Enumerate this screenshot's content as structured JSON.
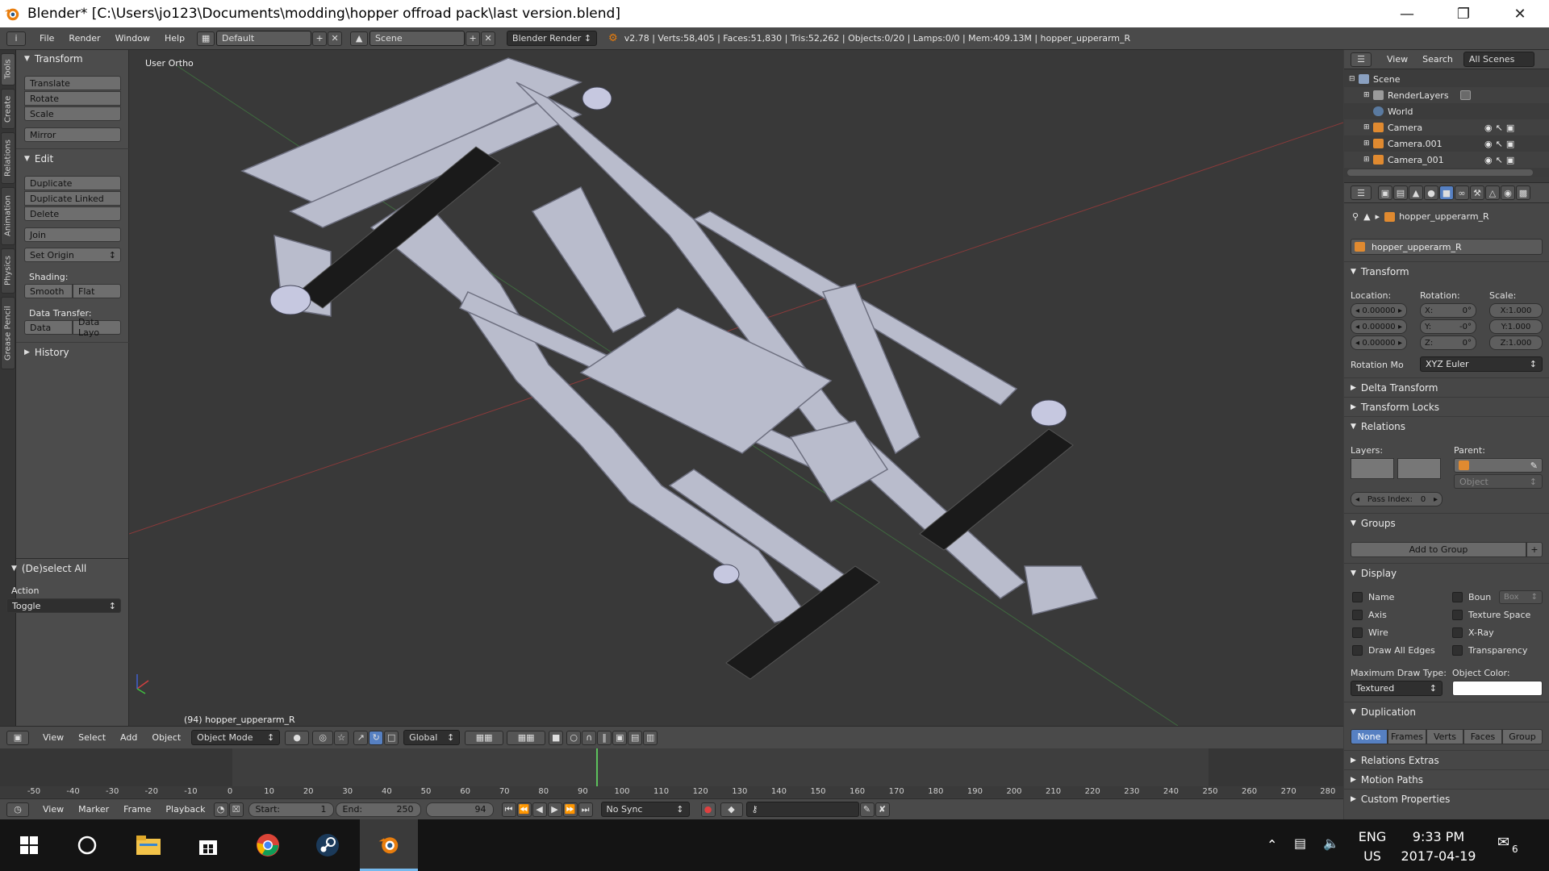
{
  "window": {
    "title": "Blender* [C:\\Users\\jo123\\Documents\\modding\\hopper offroad pack\\last version.blend]"
  },
  "info_header": {
    "menus": [
      "File",
      "Render",
      "Window",
      "Help"
    ],
    "layout": "Default",
    "scene": "Scene",
    "engine": "Blender Render",
    "stats": "v2.78 | Verts:58,405 | Faces:51,830 | Tris:52,262 | Objects:0/20 | Lamps:0/0 | Mem:409.13M | hopper_upperarm_R"
  },
  "tool_tabs": [
    "Tools",
    "Create",
    "Relations",
    "Animation",
    "Physics",
    "Grease Pencil"
  ],
  "tool_shelf": {
    "transform_header": "Transform",
    "translate": "Translate",
    "rotate": "Rotate",
    "scale": "Scale",
    "mirror": "Mirror",
    "edit_header": "Edit",
    "duplicate": "Duplicate",
    "duplicate_linked": "Duplicate Linked",
    "delete": "Delete",
    "join": "Join",
    "set_origin": "Set Origin",
    "shading_label": "Shading:",
    "smooth": "Smooth",
    "flat": "Flat",
    "data_transfer_label": "Data Transfer:",
    "data": "Data",
    "data_layout": "Data Layo",
    "history_header": "History",
    "deselect_header": "(De)select All",
    "action_label": "Action",
    "action_value": "Toggle"
  },
  "viewport": {
    "view_label": "User Ortho",
    "object_label": "(94) hopper_upperarm_R"
  },
  "view3d_header": {
    "menus": [
      "View",
      "Select",
      "Add",
      "Object"
    ],
    "mode": "Object Mode",
    "orientation": "Global"
  },
  "timeline": {
    "ticks": [
      "-50",
      "-40",
      "-30",
      "-20",
      "-10",
      "0",
      "10",
      "20",
      "30",
      "40",
      "50",
      "60",
      "70",
      "80",
      "90",
      "100",
      "110",
      "120",
      "130",
      "140",
      "150",
      "160",
      "170",
      "180",
      "190",
      "200",
      "210",
      "220",
      "230",
      "240",
      "250",
      "260",
      "270",
      "280"
    ],
    "current_frame": 94,
    "menus": [
      "View",
      "Marker",
      "Frame",
      "Playback"
    ],
    "start_label": "Start:",
    "start": "1",
    "end_label": "End:",
    "end": "250",
    "frame": "94",
    "sync": "No Sync"
  },
  "outliner": {
    "menus": [
      "View",
      "Search"
    ],
    "filter": "All Scenes",
    "items": [
      "Scene",
      "RenderLayers",
      "World",
      "Camera",
      "Camera.001",
      "Camera_001"
    ]
  },
  "properties": {
    "breadcrumb": "hopper_upperarm_R",
    "object_name": "hopper_upperarm_R",
    "transform_header": "Transform",
    "location_label": "Location:",
    "rotation_label": "Rotation:",
    "scale_label": "Scale:",
    "location": [
      "0.00000",
      "0.00000",
      "0.00000"
    ],
    "rotation": [
      {
        "axis": "X:",
        "value": "0°"
      },
      {
        "axis": "Y:",
        "value": "-0°"
      },
      {
        "axis": "Z:",
        "value": "0°"
      }
    ],
    "scale": [
      "X:1.000",
      "Y:1.000",
      "Z:1.000"
    ],
    "rotation_mode_label": "Rotation Mo",
    "rotation_mode": "XYZ Euler",
    "delta_transform": "Delta Transform",
    "transform_locks": "Transform Locks",
    "relations_header": "Relations",
    "layers_label": "Layers:",
    "parent_label": "Parent:",
    "parent_type": "Object",
    "pass_index_label": "Pass Index:",
    "pass_index": "0",
    "groups_header": "Groups",
    "add_to_group": "Add to Group",
    "display_header": "Display",
    "display_left": [
      "Name",
      "Axis",
      "Wire",
      "Draw All Edges"
    ],
    "display_right": [
      "Boun",
      "Texture Space",
      "X-Ray",
      "Transparency"
    ],
    "bounds_type": "Box",
    "max_draw_label": "Maximum Draw Type:",
    "max_draw": "Textured",
    "object_color_label": "Object Color:",
    "duplication_header": "Duplication",
    "duplication_options": [
      "None",
      "Frames",
      "Verts",
      "Faces",
      "Group"
    ],
    "relations_extras": "Relations Extras",
    "motion_paths": "Motion Paths",
    "custom_properties": "Custom Properties"
  },
  "taskbar": {
    "lang": "ENG",
    "region": "US",
    "time": "9:33 PM",
    "date": "2017-04-19",
    "notifications": "6"
  },
  "colors": {
    "accent_blue": "#5680c2",
    "timeline_cursor": "#5cc15c",
    "blender_orange": "#e87d0d"
  }
}
